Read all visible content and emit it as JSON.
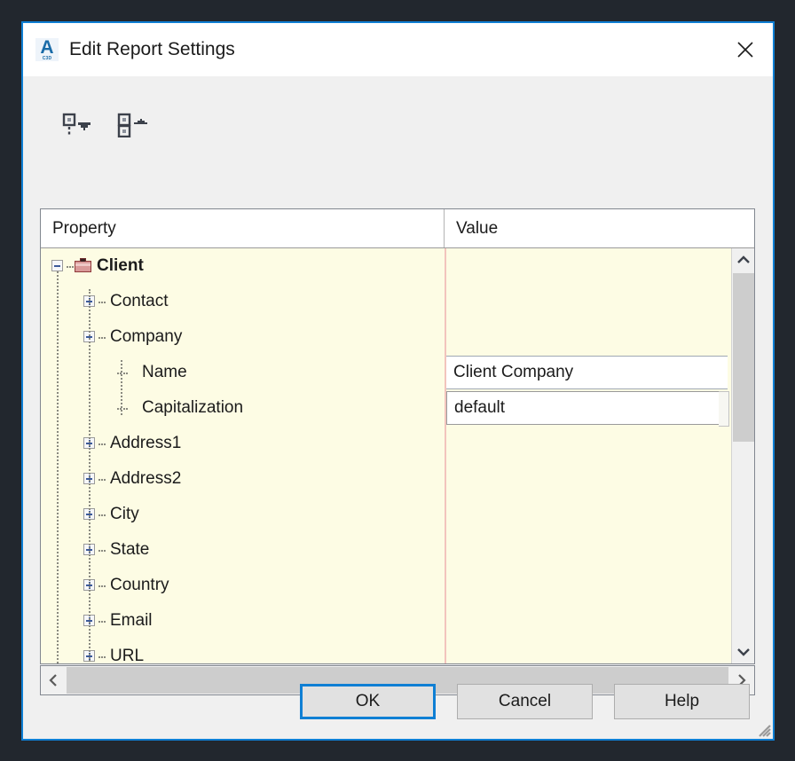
{
  "window": {
    "title": "Edit Report Settings",
    "app_icon": "autocad-civil3d-icon",
    "app_icon_letter": "A",
    "app_icon_sub": "C3D",
    "close_icon": "close-icon",
    "accent_color": "#0f7fd4",
    "desktop_color": "#22272e"
  },
  "toolbar": {
    "buttons": [
      {
        "name": "collapse-all-dropdown-button",
        "icon": "tree-collapse-dropdown-icon"
      },
      {
        "name": "sort-categorized-button",
        "icon": "sort-categorized-icon"
      }
    ]
  },
  "grid": {
    "columns": [
      {
        "key": "property",
        "label": "Property"
      },
      {
        "key": "value",
        "label": "Value"
      }
    ],
    "background_color": "#fdfce4",
    "divider_color": "#f2c4bd",
    "rows": [
      {
        "label": "Client",
        "depth": 0,
        "state": "expanded",
        "icon": "briefcase-icon",
        "bold": true,
        "value": null
      },
      {
        "label": "Contact",
        "depth": 1,
        "state": "collapsed",
        "icon": null,
        "bold": false,
        "value": null
      },
      {
        "label": "Company",
        "depth": 1,
        "state": "expanded",
        "icon": null,
        "bold": false,
        "value": null
      },
      {
        "label": "Name",
        "depth": 2,
        "state": "leaf",
        "icon": null,
        "bold": false,
        "value": "Client Company",
        "editor": "text"
      },
      {
        "label": "Capitalization",
        "depth": 2,
        "state": "leaf",
        "icon": null,
        "bold": false,
        "value": "default",
        "editor": "combo",
        "focused": true
      },
      {
        "label": "Address1",
        "depth": 1,
        "state": "collapsed",
        "icon": null,
        "bold": false,
        "value": null
      },
      {
        "label": "Address2",
        "depth": 1,
        "state": "collapsed",
        "icon": null,
        "bold": false,
        "value": null
      },
      {
        "label": "City",
        "depth": 1,
        "state": "collapsed",
        "icon": null,
        "bold": false,
        "value": null
      },
      {
        "label": "State",
        "depth": 1,
        "state": "collapsed",
        "icon": null,
        "bold": false,
        "value": null
      },
      {
        "label": "Country",
        "depth": 1,
        "state": "collapsed",
        "icon": null,
        "bold": false,
        "value": null
      },
      {
        "label": "Email",
        "depth": 1,
        "state": "collapsed",
        "icon": null,
        "bold": false,
        "value": null
      },
      {
        "label": "URL",
        "depth": 1,
        "state": "collapsed",
        "icon": null,
        "bold": false,
        "value": null
      }
    ]
  },
  "scrollbars": {
    "vertical": {
      "up_icon": "chevron-up-icon",
      "down_icon": "chevron-down-icon"
    },
    "horizontal": {
      "left_icon": "chevron-left-icon",
      "right_icon": "chevron-right-icon"
    }
  },
  "footer": {
    "buttons": [
      {
        "name": "ok-button",
        "label": "OK",
        "default": true
      },
      {
        "name": "cancel-button",
        "label": "Cancel",
        "default": false
      },
      {
        "name": "help-button",
        "label": "Help",
        "default": false
      }
    ]
  }
}
